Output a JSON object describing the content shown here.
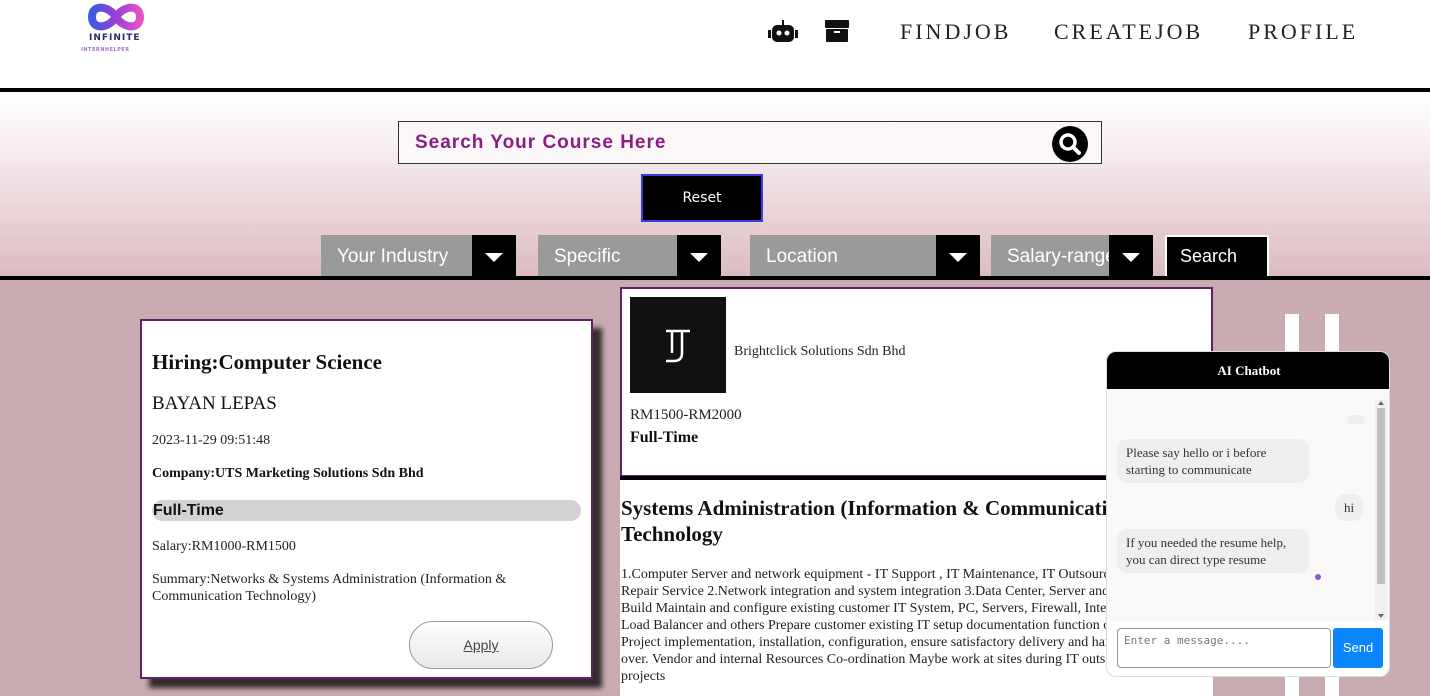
{
  "header": {
    "logo_word": "INFINITE",
    "logo_tagline": "INTERNHELPER",
    "nav": [
      {
        "label": "FINDJOB"
      },
      {
        "label": "CREATEJOB"
      },
      {
        "label": "PROFILE"
      }
    ],
    "icons": [
      "robot-icon",
      "box-icon"
    ]
  },
  "search": {
    "placeholder": "Search Your Course Here",
    "reset_label": "Reset",
    "filters": [
      {
        "label": "Your Industry"
      },
      {
        "label": "Specific"
      },
      {
        "label": "Location"
      },
      {
        "label": "Salary-range"
      }
    ],
    "search_label": "Search"
  },
  "job_card": {
    "title": "Hiring:Computer Science",
    "location": "BAYAN LEPAS",
    "posted": "2023-11-29 09:51:48",
    "company": "Company:UTS Marketing Solutions Sdn Bhd",
    "type": "Full-Time",
    "salary": "Salary:RM1000-RM1500",
    "summary": "Summary:Networks & Systems Administration (Information & Communication Technology)",
    "apply_label": "Apply"
  },
  "job_detail": {
    "company": "Brightclick Solutions Sdn Bhd",
    "salary": "RM1500-RM2000",
    "type": "Full-Time",
    "title": "Systems Administration (Information & Communication Technology",
    "description": "1.Computer Server and network equipment - IT Support , IT Maintenance, IT Outsource Repair Service 2.Network integration and system integration 3.Data Center, Server and Build Maintain and configure existing customer IT System, PC, Servers, Firewall, Internet Load Balancer and others Prepare customer existing IT setup documentation function on Project implementation, installation, configuration, ensure satisfactory delivery and hand over. Vendor and internal Resources Co-ordination Maybe work at sites during IT outsource projects"
  },
  "chatbot": {
    "title": "AI Chatbot",
    "messages": [
      {
        "from": "bot",
        "text": "Please say hello or i before starting to communicate"
      },
      {
        "from": "user",
        "text": "hi"
      },
      {
        "from": "bot",
        "text": "If you needed the resume help, you can direct type resume"
      }
    ],
    "input_placeholder": "Enter a message....",
    "send_label": "Send"
  },
  "colors": {
    "accent_purple": "#8a1e84",
    "card_border": "#60206a",
    "send_blue": "#0a84ff",
    "main_bg": "#c9abb2"
  }
}
